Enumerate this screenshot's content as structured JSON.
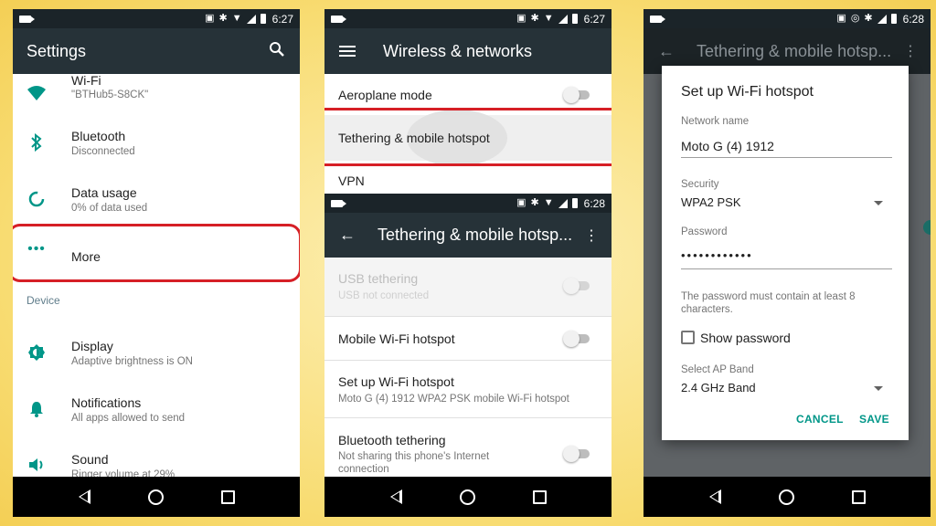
{
  "status_bar": {
    "phone1_time": "6:27",
    "phone2_time_top": "6:27",
    "phone2_time_bottom": "6:28",
    "phone3_time": "6:28"
  },
  "phone1": {
    "title": "Settings",
    "items": [
      {
        "icon": "wifi-icon",
        "title": "Wi-Fi",
        "subtitle": "\"BTHub5-S8CK\""
      },
      {
        "icon": "bluetooth-icon",
        "title": "Bluetooth",
        "subtitle": "Disconnected"
      },
      {
        "icon": "data-usage-icon",
        "title": "Data usage",
        "subtitle": "0% of data used"
      },
      {
        "icon": "more-dots-icon",
        "title": "More",
        "subtitle": ""
      }
    ],
    "section_device": "Device",
    "device_items": [
      {
        "icon": "brightness-icon",
        "title": "Display",
        "subtitle": "Adaptive brightness is ON"
      },
      {
        "icon": "bell-icon",
        "title": "Notifications",
        "subtitle": "All apps allowed to send"
      },
      {
        "icon": "speaker-icon",
        "title": "Sound",
        "subtitle": "Ringer volume at 29%"
      }
    ]
  },
  "phone2": {
    "top_title": "Wireless & networks",
    "top_items": [
      {
        "title": "Aeroplane mode"
      },
      {
        "title": "Tethering & mobile hotspot"
      },
      {
        "title": "VPN"
      }
    ],
    "bottom_title": "Tethering & mobile hotsp...",
    "bottom_items": [
      {
        "title": "USB tethering",
        "subtitle": "USB not connected"
      },
      {
        "title": "Mobile Wi-Fi hotspot",
        "subtitle": ""
      },
      {
        "title": "Set up Wi-Fi hotspot",
        "subtitle": "Moto G (4) 1912 WPA2 PSK mobile Wi-Fi hotspot"
      },
      {
        "title": "Bluetooth tethering",
        "subtitle": "Not sharing this phone's Internet connection"
      }
    ]
  },
  "phone3": {
    "bg_title": "Tethering & mobile hotsp...",
    "dialog": {
      "title": "Set up Wi-Fi hotspot",
      "network_label": "Network name",
      "network_value": "Moto G (4) 1912",
      "security_label": "Security",
      "security_value": "WPA2 PSK",
      "password_label": "Password",
      "password_value": "••••••••••••",
      "help_text": "The password must contain at least 8 characters.",
      "show_password": "Show password",
      "ap_band_label": "Select AP Band",
      "ap_band_value": "2.4 GHz Band",
      "cancel": "CANCEL",
      "save": "SAVE"
    }
  },
  "colors": {
    "accent": "#009688",
    "appbar": "#263238",
    "highlight": "#d61f26"
  }
}
